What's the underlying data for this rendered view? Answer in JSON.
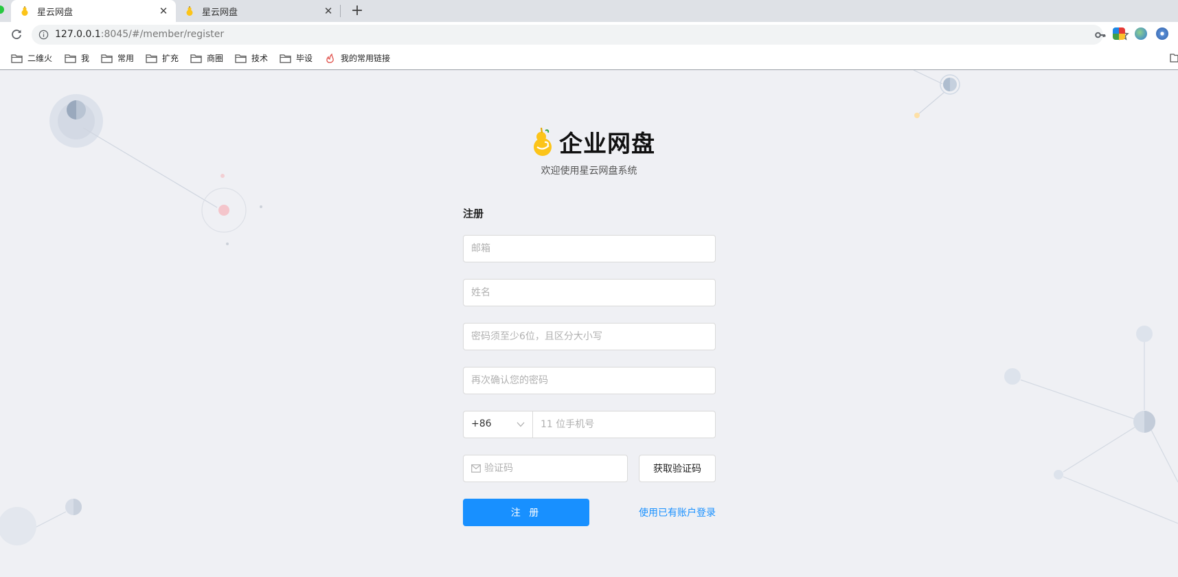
{
  "browser": {
    "tabs": [
      {
        "title": "星云网盘",
        "active": true
      },
      {
        "title": "星云网盘",
        "active": false
      }
    ],
    "close_glyph": "✕",
    "new_tab_glyph": "+",
    "url": {
      "host": "127.0.0.1",
      "rest": ":8045/#/member/register"
    },
    "bookmarks": [
      {
        "label": "二维火",
        "icon": "folder-icon"
      },
      {
        "label": "我",
        "icon": "folder-icon"
      },
      {
        "label": "常用",
        "icon": "folder-icon"
      },
      {
        "label": "扩充",
        "icon": "folder-icon"
      },
      {
        "label": "商圈",
        "icon": "folder-icon"
      },
      {
        "label": "技术",
        "icon": "folder-icon"
      },
      {
        "label": "毕设",
        "icon": "folder-icon"
      },
      {
        "label": "我的常用链接",
        "icon": "flame-icon"
      }
    ]
  },
  "brand": {
    "title": "企业网盘",
    "subtitle": "欢迎使用星云网盘系统"
  },
  "form": {
    "title": "注册",
    "email_placeholder": "邮箱",
    "name_placeholder": "姓名",
    "password_placeholder": "密码须至少6位，且区分大小写",
    "confirm_placeholder": "再次确认您的密码",
    "country_code": "+86",
    "phone_placeholder": "11 位手机号",
    "code_placeholder": "验证码",
    "get_code_label": "获取验证码",
    "submit_label": "注 册",
    "login_link": "使用已有账户登录"
  },
  "colors": {
    "primary": "#1890ff",
    "background": "#eff0f4",
    "logo": "#fcc419"
  }
}
